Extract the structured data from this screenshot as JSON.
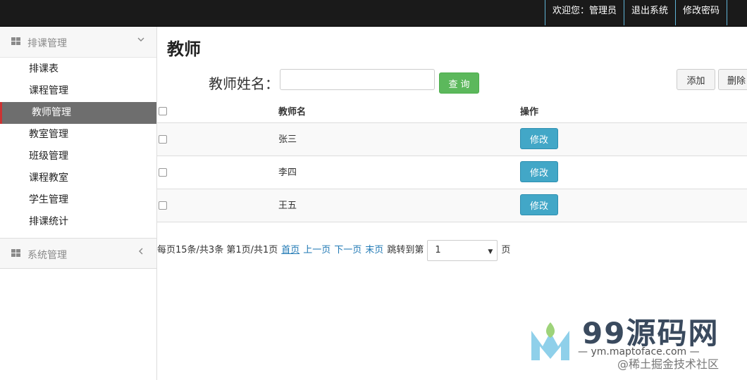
{
  "topnav": {
    "welcome": "欢迎您：管理员",
    "logout": "退出系统",
    "change_password": "修改密码"
  },
  "sidebar": {
    "group1": {
      "label": "排课管理",
      "icon": "grid-icon",
      "chevron": "chevron-down-icon"
    },
    "items": [
      {
        "label": "排课表"
      },
      {
        "label": "课程管理"
      },
      {
        "label": "教师管理",
        "active": true
      },
      {
        "label": "教室管理"
      },
      {
        "label": "班级管理"
      },
      {
        "label": "课程教室"
      },
      {
        "label": "学生管理"
      },
      {
        "label": "排课统计"
      }
    ],
    "group2": {
      "label": "系统管理",
      "icon": "grid-icon",
      "chevron": "chevron-left-icon"
    }
  },
  "main": {
    "title": "教师",
    "search": {
      "label": "教师姓名：",
      "value": "",
      "query_button": "查询"
    },
    "add_button": "添加",
    "delete_button": "删除",
    "table": {
      "headers": [
        "教师名",
        "操作"
      ],
      "rows": [
        {
          "name": "张三",
          "action": "修改"
        },
        {
          "name": "李四",
          "action": "修改"
        },
        {
          "name": "王五",
          "action": "修改"
        }
      ]
    },
    "pager": {
      "info": "每页15条/共3条 第1页/共1页",
      "first": "首页",
      "prev": "上一页",
      "next": "下一页",
      "last": "末页",
      "jump_label": "跳转到第",
      "page_value": "1",
      "page_suffix": "页"
    }
  },
  "watermark": {
    "brand": "99源码网",
    "url": "— ym.maptoface.com —",
    "signature": "@稀土掘金技术社区"
  },
  "colors": {
    "topbar": "#1a1a1a",
    "query_green": "#5cb85c",
    "edit_blue": "#42a7c7",
    "active_item": "#6e6e6e",
    "link": "#1f78b4"
  }
}
